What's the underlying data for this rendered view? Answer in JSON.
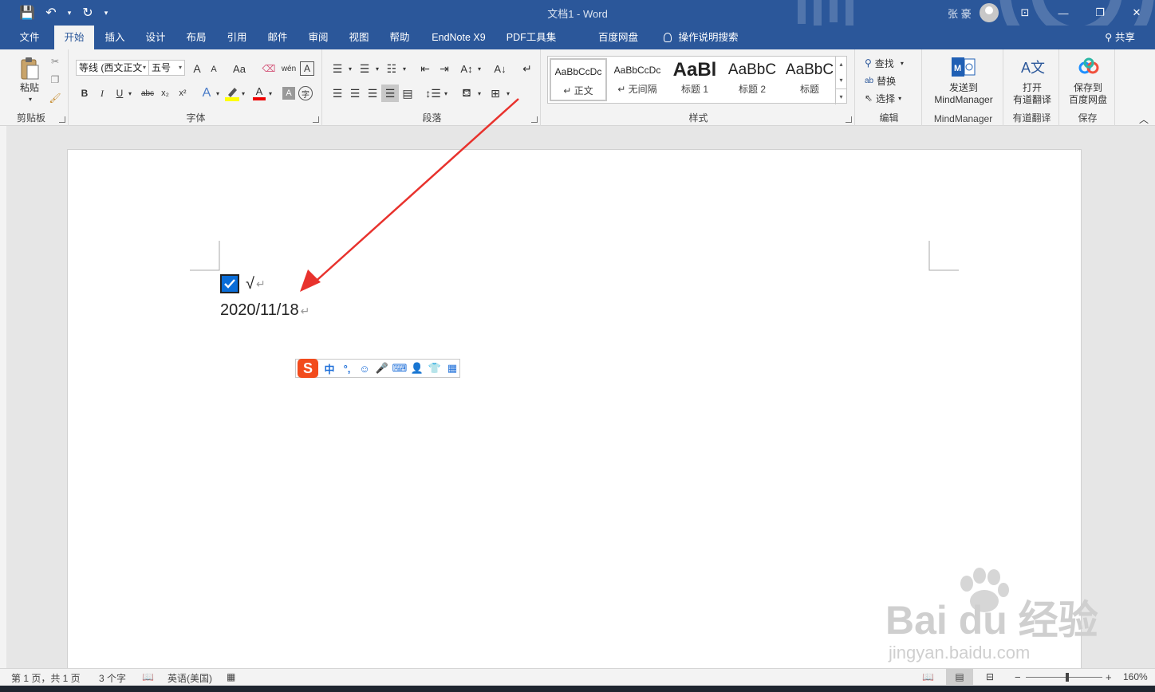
{
  "titlebar": {
    "title": "文档1  -  Word",
    "user": "张 豪",
    "qat": {
      "save_icon": "💾",
      "undo_icon": "↶",
      "undo_dd": "▾",
      "redo_icon": "↻",
      "custom_dd": "▾"
    },
    "controls": {
      "restore_ribbon": "⊡",
      "minimize": "—",
      "maximize": "❐",
      "close": "✕"
    }
  },
  "tabs": [
    "文件",
    "开始",
    "插入",
    "设计",
    "布局",
    "引用",
    "邮件",
    "审阅",
    "视图",
    "帮助",
    "EndNote X9",
    "PDF工具集",
    "百度网盘",
    "操作说明搜索",
    "共享"
  ],
  "ribbon": {
    "clipboard": {
      "paste": "粘贴",
      "label": "剪贴板"
    },
    "font": {
      "font_name": "等线 (西文正文",
      "font_size": "五号",
      "grow": "A",
      "shrink": "A",
      "case": "Aa",
      "bold": "B",
      "italic": "I",
      "underline": "U",
      "strike": "abc",
      "sub": "x₂",
      "sup": "x²",
      "font_color_a": "A",
      "label": "字体"
    },
    "paragraph": {
      "label": "段落"
    },
    "styles": {
      "label": "样式",
      "items": [
        {
          "sample": "AaBbCcDc",
          "name": "↵ 正文"
        },
        {
          "sample": "AaBbCcDc",
          "name": "↵ 无间隔"
        },
        {
          "sample": "AaBl",
          "name": "标题 1"
        },
        {
          "sample": "AaBbC",
          "name": "标题 2"
        },
        {
          "sample": "AaBbC",
          "name": "标题"
        }
      ]
    },
    "editing": {
      "find": "查找",
      "replace": "替换",
      "select": "选择",
      "label": "编辑"
    },
    "mindmanager": {
      "btn_line1": "发送到",
      "btn_line2": "MindManager",
      "label": "MindManager"
    },
    "youdao": {
      "btn_line1": "打开",
      "btn_line2": "有道翻译",
      "label": "有道翻译"
    },
    "baidu": {
      "btn_line1": "保存到",
      "btn_line2": "百度网盘",
      "label": "保存"
    }
  },
  "document": {
    "line1_text": "√",
    "line2_text": "2020/11/18",
    "para_mark": "↵",
    "checkbox_checked": true
  },
  "ime": {
    "logo": "S",
    "items": [
      "中",
      "°,",
      "☺",
      "🎤",
      "⌨",
      "👤",
      "👕",
      "▦"
    ]
  },
  "status": {
    "page": "第 1 页，共 1 页",
    "words": "3 个字",
    "language": "英语(美国)",
    "zoom": "160%",
    "zoom_minus": "−",
    "zoom_plus": "+"
  },
  "watermark": {
    "brand": "Bai  du 经验",
    "url": "jingyan.baidu.com"
  },
  "colors": {
    "accent": "#2b579a",
    "arrow": "#e8322d",
    "checkbox": "#0a6dd8",
    "ime_logo": "#f24b1c"
  }
}
